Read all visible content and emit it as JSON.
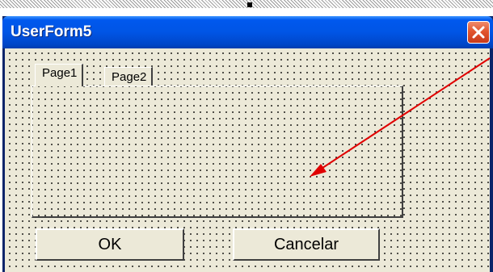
{
  "window": {
    "title": "UserForm5"
  },
  "multipage": {
    "tabs": [
      {
        "label": "Page1",
        "active": true
      },
      {
        "label": "Page2",
        "active": false
      }
    ]
  },
  "buttons": {
    "ok_label": "OK",
    "cancel_label": "Cancelar"
  },
  "icons": {
    "close": "close-icon",
    "arrow": "red-arrow-annotation"
  },
  "colors": {
    "arrow": "#e00000",
    "form_bg": "#ece9d8",
    "title_bar": "#0055e5",
    "close_button": "#e2562f"
  }
}
